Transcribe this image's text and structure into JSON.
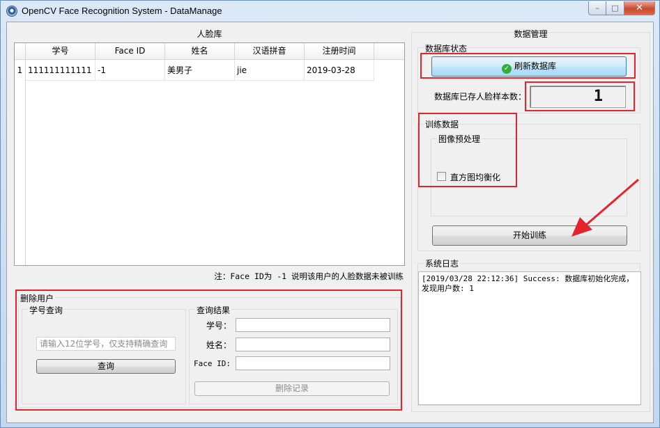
{
  "window": {
    "title": "OpenCV Face Recognition System - DataManage",
    "minimize": "–",
    "maximize": "□",
    "close": "✕"
  },
  "face_db": {
    "title": "人脸库",
    "columns": [
      "学号",
      "Face ID",
      "姓名",
      "汉语拼音",
      "注册时间"
    ],
    "rows": [
      {
        "index": "1",
        "cells": [
          "111111111111",
          "-1",
          "美男子",
          "jie",
          "2019-03-28"
        ]
      }
    ],
    "note": "注：Face ID为 -1 说明该用户的人脸数据未被训练"
  },
  "delete_user": {
    "title": "删除用户",
    "query_group": "学号查询",
    "student_id_placeholder": "请输入12位学号，仅支持精确查询",
    "query_button": "查询",
    "result_group": "查询结果",
    "field_id": "学号：",
    "field_name": "姓名：",
    "field_faceid": "Face ID:",
    "delete_button": "删除记录"
  },
  "data_manage": {
    "title": "数据管理",
    "db_status": {
      "title": "数据库状态",
      "refresh_button": "刷新数据库",
      "count_label": "数据库已存人脸样本数：",
      "count_value": "1"
    },
    "training": {
      "title": "训练数据",
      "preprocess_title": "图像预处理",
      "histogram_label": "直方图均衡化",
      "train_button": "开始训练"
    },
    "log": {
      "title": "系统日志",
      "text": "[2019/03/28 22:12:36] Success: 数据库初始化完成，发现用户数: 1"
    }
  },
  "colors": {
    "highlight_red": "#e4232d",
    "arrow_red": "#e4232d"
  }
}
